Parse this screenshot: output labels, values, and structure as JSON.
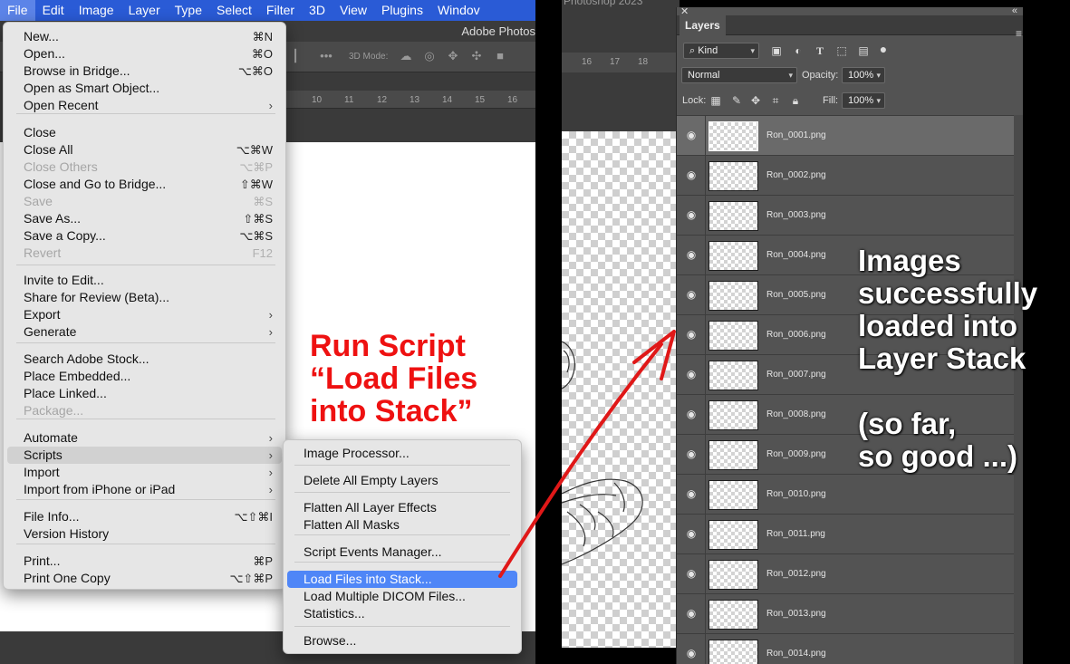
{
  "menubar": {
    "items": [
      {
        "label": "File",
        "active": true
      },
      {
        "label": "Edit"
      },
      {
        "label": "Image"
      },
      {
        "label": "Layer"
      },
      {
        "label": "Type"
      },
      {
        "label": "Select"
      },
      {
        "label": "Filter"
      },
      {
        "label": "3D"
      },
      {
        "label": "View"
      },
      {
        "label": "Plugins"
      },
      {
        "label": "Windov"
      }
    ],
    "color": "#2a5bd6"
  },
  "toolbar": {
    "doc_title": "Adobe Photos",
    "mode3d_label": "3D Mode:",
    "more_icon": "•••"
  },
  "ruler_left": [
    "10",
    "11",
    "12",
    "13",
    "14",
    "15",
    "16"
  ],
  "file_menu": {
    "items": [
      {
        "label": "New...",
        "shortcut": "⌘N"
      },
      {
        "label": "Open...",
        "shortcut": "⌘O"
      },
      {
        "label": "Browse in Bridge...",
        "shortcut": "⌥⌘O"
      },
      {
        "label": "Open as Smart Object..."
      },
      {
        "label": "Open Recent",
        "submenu": true
      },
      {
        "label": "Close"
      },
      {
        "label": "Close All",
        "shortcut": "⌥⌘W"
      },
      {
        "label": "Close Others",
        "shortcut": "⌥⌘P",
        "disabled": true
      },
      {
        "label": "Close and Go to Bridge...",
        "shortcut": "⇧⌘W"
      },
      {
        "label": "Save",
        "shortcut": "⌘S",
        "disabled": true
      },
      {
        "label": "Save As...",
        "shortcut": "⇧⌘S"
      },
      {
        "label": "Save a Copy...",
        "shortcut": "⌥⌘S"
      },
      {
        "label": "Revert",
        "shortcut": "F12",
        "disabled": true
      },
      {
        "label": "Invite to Edit..."
      },
      {
        "label": "Share for Review (Beta)..."
      },
      {
        "label": "Export",
        "submenu": true
      },
      {
        "label": "Generate",
        "submenu": true
      },
      {
        "label": "Search Adobe Stock..."
      },
      {
        "label": "Place Embedded..."
      },
      {
        "label": "Place Linked..."
      },
      {
        "label": "Package...",
        "disabled": true
      },
      {
        "label": "Automate",
        "submenu": true
      },
      {
        "label": "Scripts",
        "submenu": true,
        "highlighted": true
      },
      {
        "label": "Import",
        "submenu": true
      },
      {
        "label": "Import from iPhone or iPad",
        "submenu": true
      },
      {
        "label": "File Info...",
        "shortcut": "⌥⇧⌘I"
      },
      {
        "label": "Version History"
      },
      {
        "label": "Print...",
        "shortcut": "⌘P"
      },
      {
        "label": "Print One Copy",
        "shortcut": "⌥⇧⌘P"
      }
    ]
  },
  "scripts_menu": {
    "items": [
      {
        "label": "Image Processor..."
      },
      {
        "label": "Delete All Empty Layers"
      },
      {
        "label": "Flatten All Layer Effects"
      },
      {
        "label": "Flatten All Masks"
      },
      {
        "label": "Script Events Manager..."
      },
      {
        "label": "Load Files into Stack...",
        "selected": true
      },
      {
        "label": "Load Multiple DICOM Files..."
      },
      {
        "label": "Statistics..."
      },
      {
        "label": "Browse..."
      }
    ]
  },
  "annotations": {
    "left": [
      "Run Script",
      "“Load Files",
      "into Stack”"
    ],
    "right": [
      "Images",
      "successfully",
      "loaded into",
      "Layer Stack",
      "",
      "(so far,",
      "so good ...)"
    ],
    "left_color": "#ee1111",
    "arrow_color": "#e01818"
  },
  "right_canvas": {
    "ruler": [
      "16",
      "17",
      "18"
    ]
  },
  "layers_panel": {
    "tab_label": "Layers",
    "filter_kind": "Kind",
    "blend_mode": "Normal",
    "opacity_label": "Opacity:",
    "opacity_value": "100%",
    "lock_label": "Lock:",
    "fill_label": "Fill:",
    "fill_value": "100%",
    "layers": [
      {
        "name": "Ron_0001.png",
        "selected": true
      },
      {
        "name": "Ron_0002.png"
      },
      {
        "name": "Ron_0003.png"
      },
      {
        "name": "Ron_0004.png"
      },
      {
        "name": "Ron_0005.png"
      },
      {
        "name": "Ron_0006.png"
      },
      {
        "name": "Ron_0007.png"
      },
      {
        "name": "Ron_0008.png"
      },
      {
        "name": "Ron_0009.png"
      },
      {
        "name": "Ron_0010.png"
      },
      {
        "name": "Ron_0011.png"
      },
      {
        "name": "Ron_0012.png"
      },
      {
        "name": "Ron_0013.png"
      },
      {
        "name": "Ron_0014.png"
      }
    ]
  }
}
